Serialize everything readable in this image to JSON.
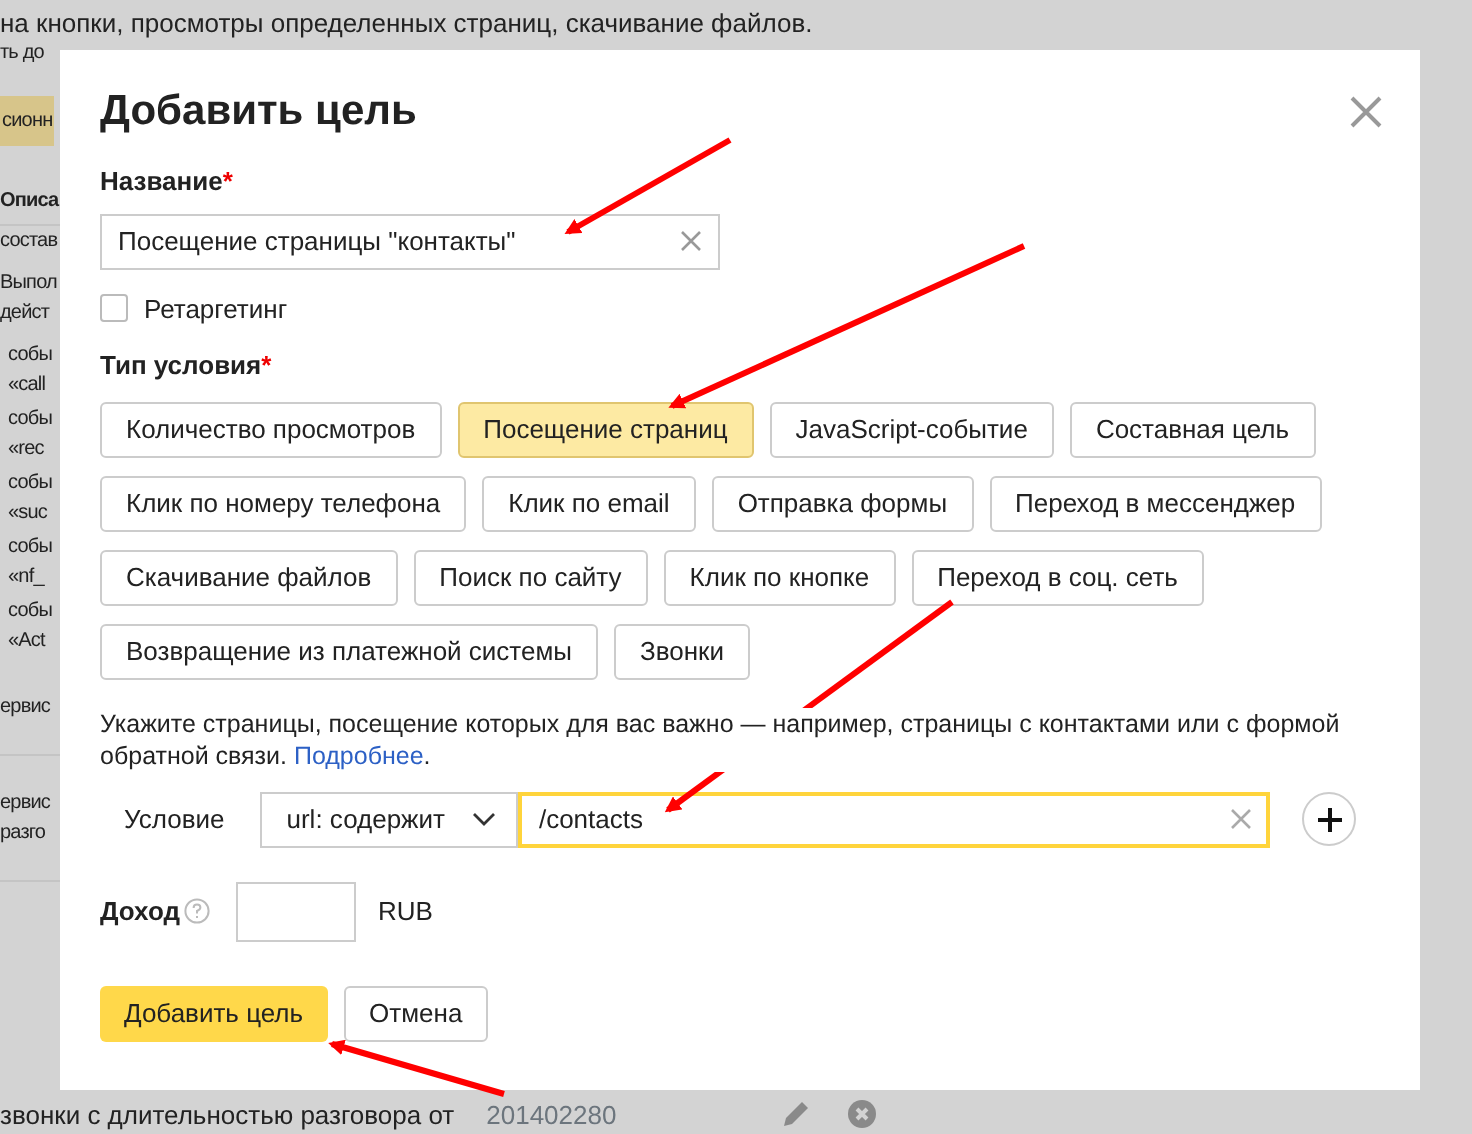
{
  "background_page": {
    "blocks": [
      {
        "kind": "text",
        "lines": [
          "на кнопки, просмотры определенных страниц, скачивание файлов.",
          "ть до"
        ]
      },
      {
        "kind": "button",
        "lines": [
          "сионн"
        ]
      },
      {
        "kind": "heading",
        "lines": [
          "Описа"
        ]
      },
      {
        "kind": "text",
        "lines": [
          "состав"
        ]
      },
      {
        "kind": "text",
        "lines": [
          "Выпол",
          "дейст"
        ]
      },
      {
        "kind": "event",
        "lines": [
          "собы",
          "«call"
        ]
      },
      {
        "kind": "event",
        "lines": [
          "собы",
          "«rec"
        ]
      },
      {
        "kind": "event",
        "lines": [
          "собы",
          "«suc"
        ]
      },
      {
        "kind": "event",
        "lines": [
          "собы",
          "«nf_"
        ]
      },
      {
        "kind": "event",
        "lines": [
          "собы",
          "«Act"
        ]
      },
      {
        "kind": "row",
        "lines": [
          "ервис"
        ]
      },
      {
        "kind": "row",
        "lines": [
          "ервис",
          "разго"
        ]
      }
    ],
    "footer_row": {
      "text": "звонки с длительностью разговора от",
      "id": "201402280"
    }
  },
  "dialog": {
    "title": "Добавить цель",
    "name_field": {
      "label": "Название",
      "required_mark": "*",
      "value": "Посещение страницы \"контакты\""
    },
    "retargeting": {
      "label": "Ретаргетинг",
      "checked": false
    },
    "condition_type": {
      "label": "Тип условия",
      "required_mark": "*",
      "options": [
        {
          "label": "Количество просмотров",
          "selected": false
        },
        {
          "label": "Посещение страниц",
          "selected": true
        },
        {
          "label": "JavaScript-событие",
          "selected": false
        },
        {
          "label": "Составная цель",
          "selected": false
        },
        {
          "label": "Клик по номеру телефона",
          "selected": false
        },
        {
          "label": "Клик по email",
          "selected": false
        },
        {
          "label": "Отправка формы",
          "selected": false
        },
        {
          "label": "Переход в мессенджер",
          "selected": false
        },
        {
          "label": "Скачивание файлов",
          "selected": false
        },
        {
          "label": "Поиск по сайту",
          "selected": false
        },
        {
          "label": "Клик по кнопке",
          "selected": false
        },
        {
          "label": "Переход в соц. сеть",
          "selected": false
        },
        {
          "label": "Возвращение из платежной системы",
          "selected": false
        },
        {
          "label": "Звонки",
          "selected": false
        }
      ]
    },
    "hint": "Укажите страницы, посещение которых для вас важно — например, страницы с контактами или с формой обратной связи.",
    "hint_link": "Подробнее",
    "hint_end": ".",
    "condition": {
      "label": "Условие",
      "operator": "url: содержит",
      "value": "/contacts"
    },
    "income": {
      "label": "Доход",
      "currency": "RUB"
    },
    "buttons": [
      {
        "label": "Добавить цель",
        "kind": "primary"
      },
      {
        "label": "Отмена",
        "kind": "secondary"
      }
    ]
  }
}
